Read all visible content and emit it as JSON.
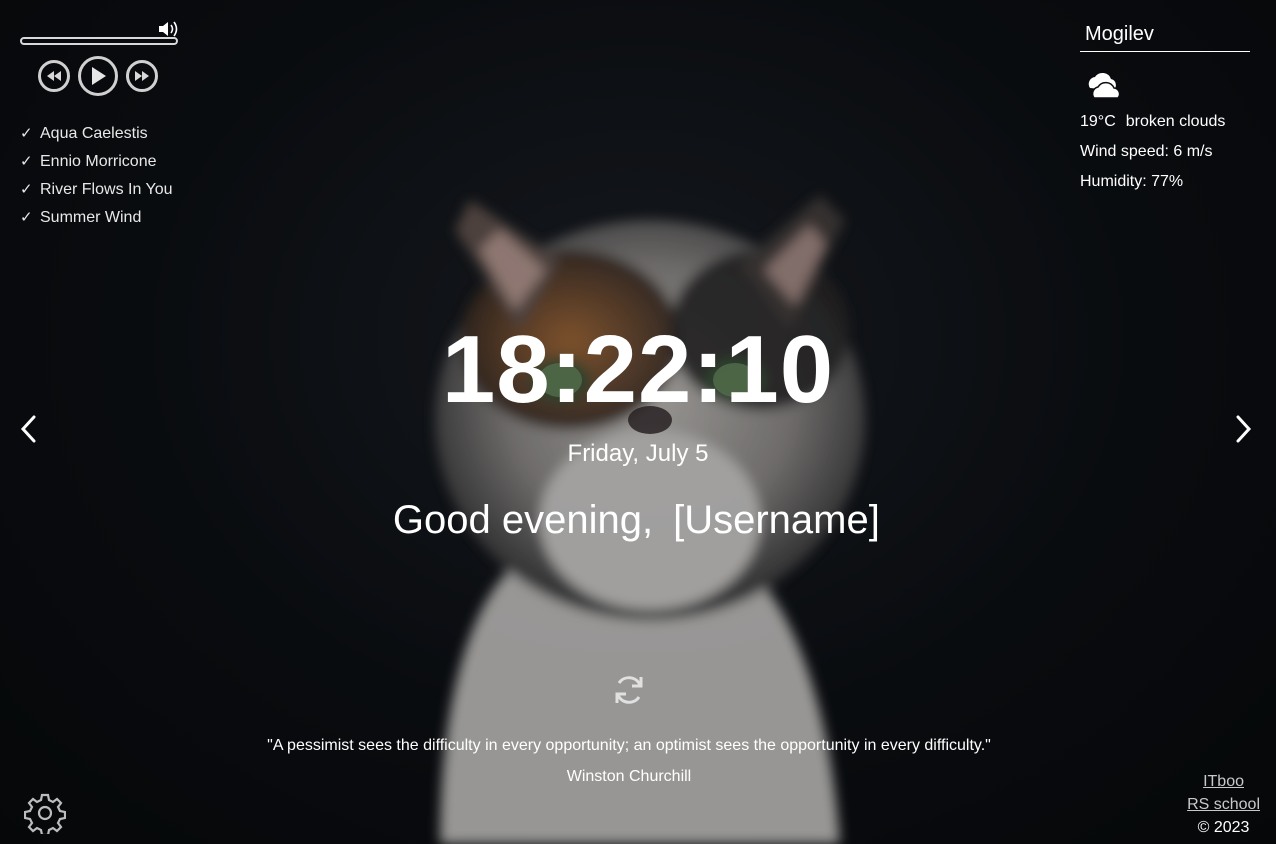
{
  "player": {
    "icons": {
      "volume": "volume-icon",
      "prev": "rewind-icon",
      "play": "play-icon",
      "next": "fast-forward-icon"
    },
    "playlist": [
      {
        "title": "Aqua Caelestis"
      },
      {
        "title": "Ennio Morricone"
      },
      {
        "title": "River Flows In You"
      },
      {
        "title": "Summer Wind"
      }
    ],
    "check_mark": "✓"
  },
  "weather": {
    "city": "Mogilev",
    "icon": "broken-clouds-icon",
    "temperature": "19°C",
    "description": "broken clouds",
    "wind": "Wind speed: 6 m/s",
    "humidity": "Humidity: 77%"
  },
  "clock": {
    "time": "18:22:10",
    "date": "Friday, July 5"
  },
  "greeting": {
    "text": "Good evening,",
    "name_placeholder": "[Username]"
  },
  "quote": {
    "text": "\"A pessimist sees the difficulty in every opportunity; an optimist sees the opportunity in every difficulty.\"",
    "author": "Winston Churchill"
  },
  "footer": {
    "link1": "ITboo",
    "link2": "RS school",
    "copyright": "© 2023"
  },
  "colors": {
    "text": "#ffffff",
    "controls": "#d0d0d0",
    "background": "#0b0d10"
  }
}
